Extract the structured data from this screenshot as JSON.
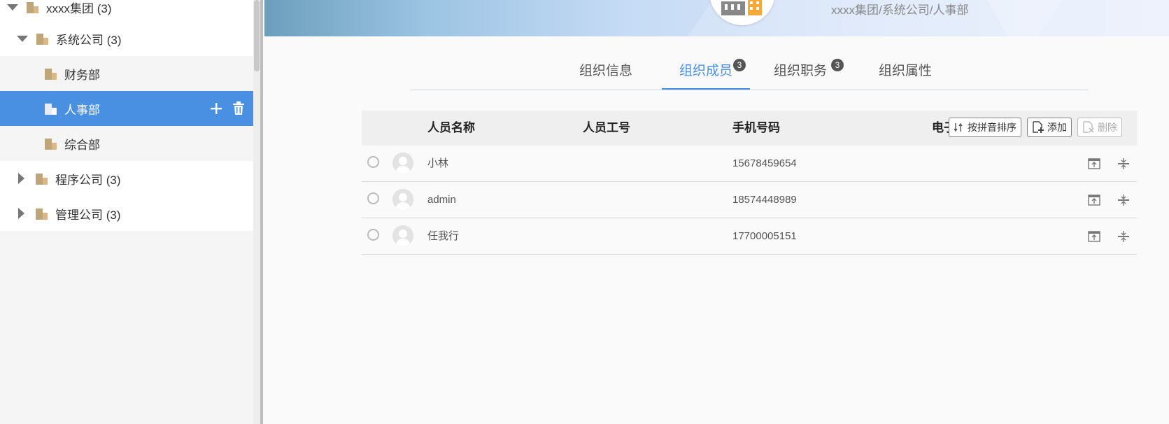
{
  "sidebar": {
    "tree": [
      {
        "label": "xxxx集团 (3)",
        "expanded": true
      },
      {
        "label": "系统公司 (3)",
        "expanded": true
      },
      {
        "label": "财务部"
      },
      {
        "label": "人事部",
        "selected": true
      },
      {
        "label": "综合部"
      },
      {
        "label": "程序公司 (3)",
        "expanded": false
      },
      {
        "label": "管理公司 (3)",
        "expanded": false
      }
    ]
  },
  "header": {
    "breadcrumb": "xxxx集团/系统公司/人事部"
  },
  "tabs": [
    {
      "label": "组织信息"
    },
    {
      "label": "组织成员",
      "badge": "3",
      "active": true
    },
    {
      "label": "组织职务",
      "badge": "3"
    },
    {
      "label": "组织属性"
    }
  ],
  "table": {
    "columns": [
      "人员名称",
      "人员工号",
      "手机号码",
      "电子"
    ],
    "toolbar": {
      "sort_label": "按拼音排序",
      "add_label": "添加",
      "delete_label": "删除"
    },
    "rows": [
      {
        "name": "小林",
        "employee_id": "",
        "phone": "15678459654"
      },
      {
        "name": "admin",
        "employee_id": "",
        "phone": "18574448989"
      },
      {
        "name": "任我行",
        "employee_id": "",
        "phone": "17700005151"
      }
    ]
  },
  "colors": {
    "accent": "#4a90e2",
    "building_icon": "#c9a26a"
  }
}
